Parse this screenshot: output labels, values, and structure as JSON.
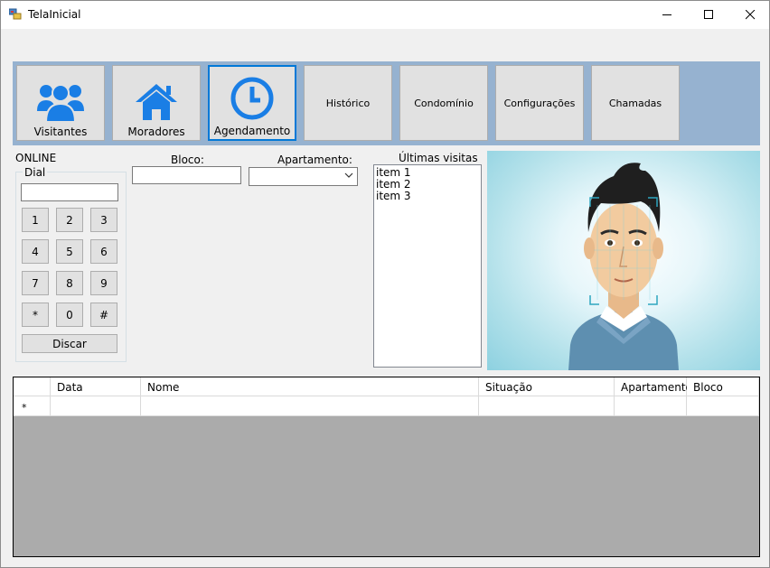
{
  "window": {
    "title": "TelaInicial"
  },
  "toolbar": {
    "buttons": [
      {
        "label": "Visitantes",
        "icon": "users-icon"
      },
      {
        "label": "Moradores",
        "icon": "home-icon"
      },
      {
        "label": "Agendamento",
        "icon": "clock-icon",
        "active": true
      },
      {
        "label": "Histórico"
      },
      {
        "label": "Condomínio"
      },
      {
        "label": "Configurações"
      },
      {
        "label": "Chamadas"
      }
    ],
    "accent": "#1a7ee5"
  },
  "dialer": {
    "status": "ONLINE",
    "group_label": "Dial",
    "input_value": "",
    "keys": [
      "1",
      "2",
      "3",
      "4",
      "5",
      "6",
      "7",
      "8",
      "9",
      "*",
      "0",
      "#"
    ],
    "call_button": "Discar"
  },
  "form": {
    "bloco_label": "Bloco:",
    "bloco_value": "",
    "apartamento_label": "Apartamento:",
    "apartamento_value": ""
  },
  "visits": {
    "label": "Últimas visitas",
    "items": [
      "item 1",
      "item 2",
      "item 3"
    ]
  },
  "grid": {
    "columns": [
      "",
      "Data",
      "Nome",
      "Situação",
      "Apartamento",
      "Bloco"
    ],
    "new_row_marker": "*"
  }
}
